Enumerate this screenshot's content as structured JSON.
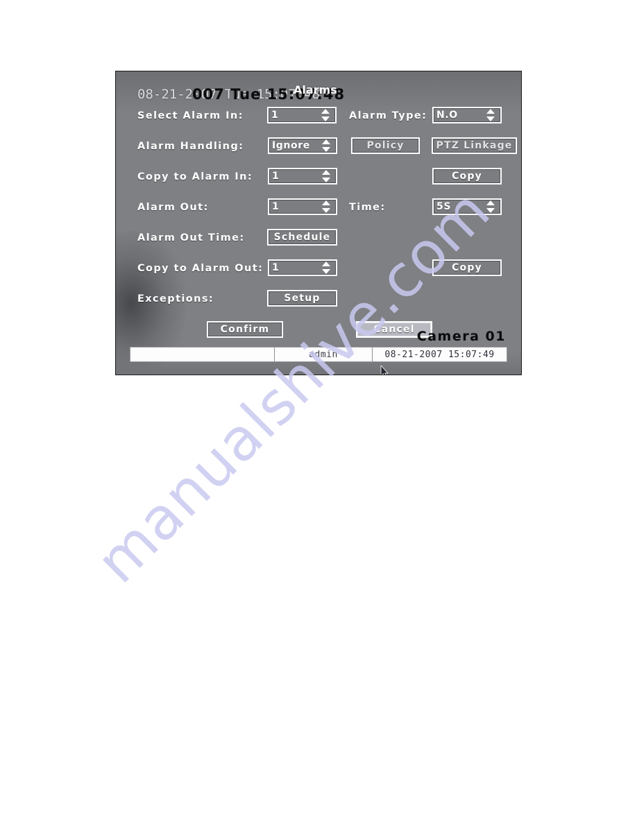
{
  "watermark": {
    "text": "manualshive.com"
  },
  "screen": {
    "osd_datetime": "08-21-2007 Tue 15:07:48",
    "menu_clock": "007 Tue 15:07:48",
    "menu_title": "Alarms",
    "camera_caption": "Camera 01"
  },
  "form": {
    "rows": {
      "select_alarm_in": {
        "label": "Select Alarm In:",
        "value": "1",
        "type_label": "Alarm Type:",
        "type_value": "N.O"
      },
      "alarm_handling": {
        "label": "Alarm Handling:",
        "value": "Ignore",
        "policy_label": "Policy",
        "ptz_linkage_label": "PTZ Linkage"
      },
      "copy_to_alarm_in": {
        "label": "Copy to Alarm In:",
        "value": "1",
        "copy_label": "Copy"
      },
      "alarm_out": {
        "label": "Alarm Out:",
        "value": "1",
        "time_label": "Time:",
        "time_value": "5S"
      },
      "alarm_out_time": {
        "label": "Alarm Out Time:",
        "schedule_label": "Schedule"
      },
      "copy_to_alarm_out": {
        "label": "Copy to Alarm Out:",
        "value": "1",
        "copy_label": "Copy"
      },
      "exceptions": {
        "label": "Exceptions:",
        "setup_label": "Setup"
      }
    },
    "actions": {
      "confirm_label": "Confirm",
      "cancel_label": "Cancel"
    }
  },
  "statusbar": {
    "message": "",
    "user": "admin",
    "datetime": "08-21-2007 15:07:49"
  },
  "colors": {
    "panel_bg": "#7e8084",
    "field_border": "#ffffff",
    "label_text": "#ffffff",
    "focus_bg": "#b9b9c2",
    "statusbar_bg": "#fdfdfd",
    "watermark": "#c9c9f0"
  }
}
